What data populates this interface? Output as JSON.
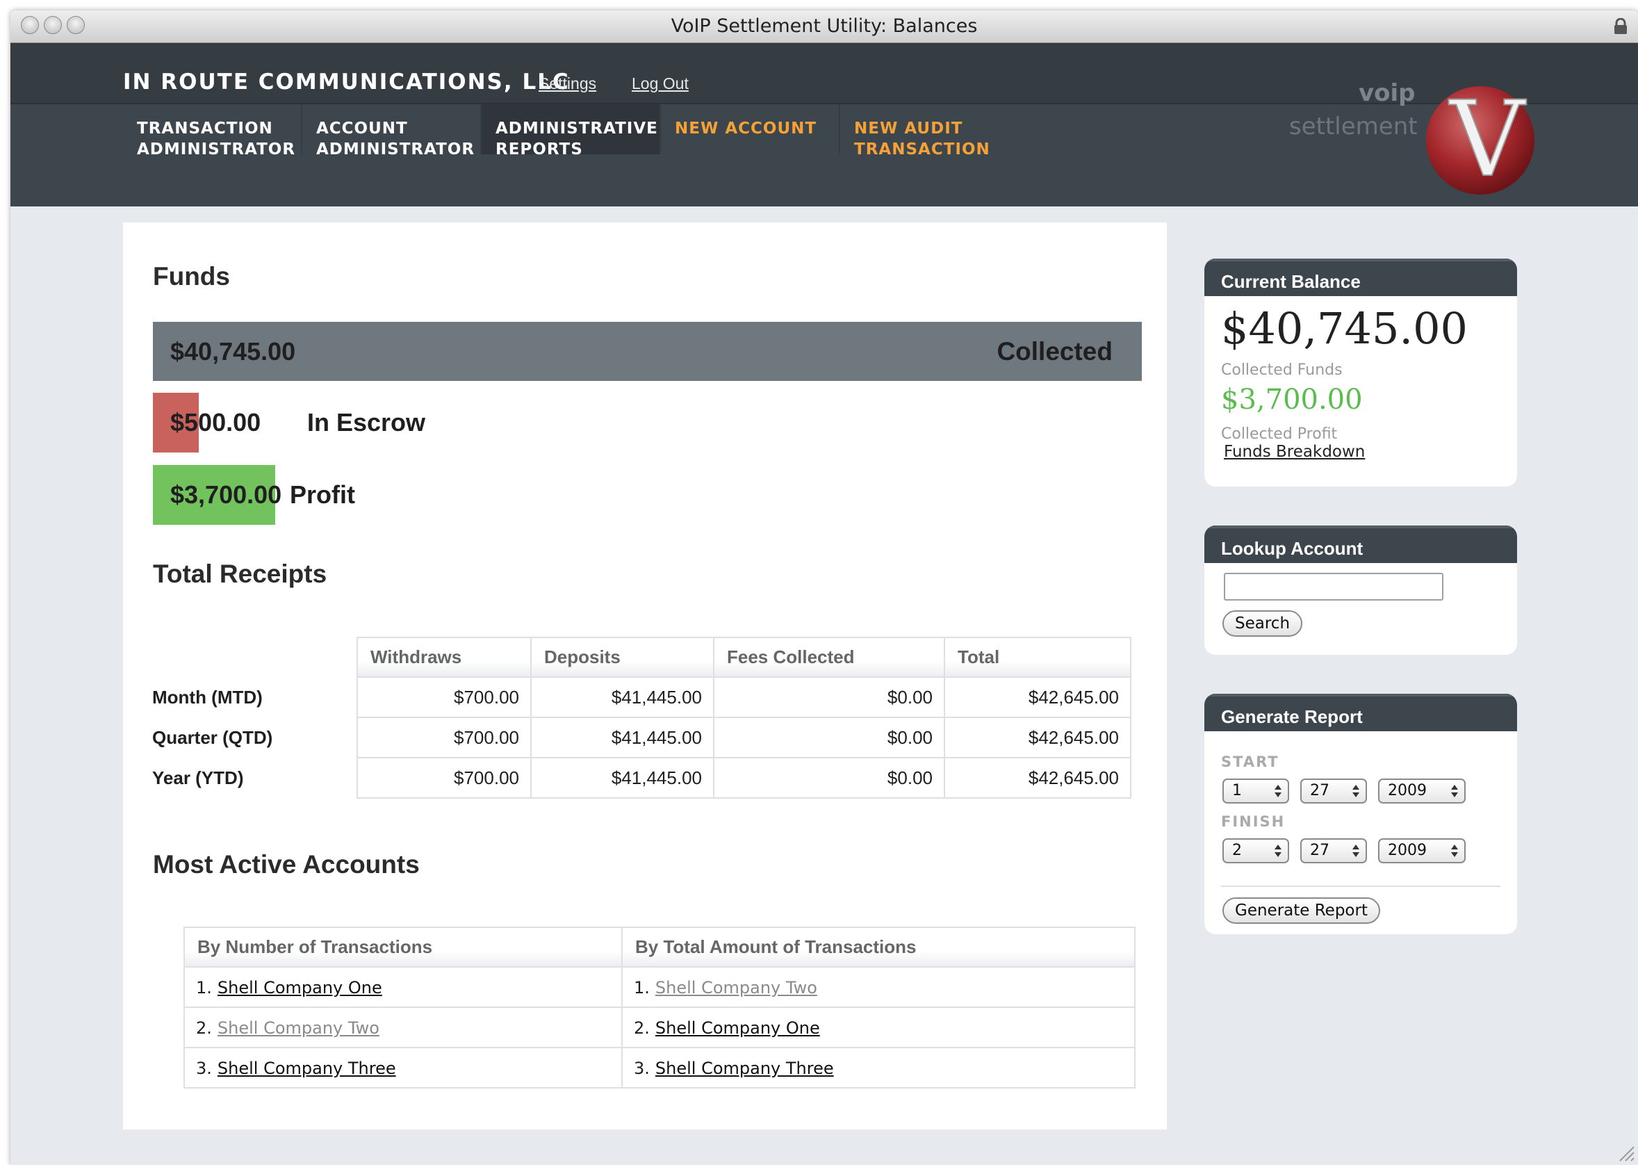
{
  "window": {
    "title": "VoIP Settlement Utility: Balances"
  },
  "header": {
    "company": "IN ROUTE COMMUNICATIONS, LLC",
    "links": {
      "settings": "Settings",
      "logout": "Log Out"
    },
    "logo": {
      "voip": "voip",
      "settlement": "settlement",
      "letter": "V"
    }
  },
  "nav": [
    {
      "label": "TRANSACTION\nADMINISTRATOR"
    },
    {
      "label": "ACCOUNT\nADMINISTRATOR"
    },
    {
      "label": "ADMINISTRATIVE\nREPORTS"
    },
    {
      "label": "NEW ACCOUNT"
    },
    {
      "label": "NEW AUDIT\nTRANSACTION"
    }
  ],
  "funds": {
    "title": "Funds",
    "collected": {
      "value": "$40,745.00",
      "label": "Collected"
    },
    "escrow": {
      "value": "$500.00",
      "label": "In Escrow"
    },
    "profit": {
      "value": "$3,700.00",
      "label": "Profit"
    },
    "colors": {
      "collected": "#70787f",
      "escrow": "#c9625c",
      "profit": "#72c35d"
    }
  },
  "receipts": {
    "title": "Total Receipts",
    "columns": [
      "Withdraws",
      "Deposits",
      "Fees Collected",
      "Total"
    ],
    "rows": [
      {
        "label": "Month (MTD)",
        "cells": [
          "$700.00",
          "$41,445.00",
          "$0.00",
          "$42,645.00"
        ]
      },
      {
        "label": "Quarter (QTD)",
        "cells": [
          "$700.00",
          "$41,445.00",
          "$0.00",
          "$42,645.00"
        ]
      },
      {
        "label": "Year (YTD)",
        "cells": [
          "$700.00",
          "$41,445.00",
          "$0.00",
          "$42,645.00"
        ]
      }
    ]
  },
  "active": {
    "title": "Most Active Accounts",
    "columns": [
      "By Number of Transactions",
      "By Total Amount of Transactions"
    ],
    "rows": [
      {
        "left": {
          "rank": "1.",
          "name": "Shell Company One"
        },
        "right": {
          "rank": "1.",
          "name": "Shell Company Two"
        }
      },
      {
        "left": {
          "rank": "2.",
          "name": "Shell Company Two"
        },
        "right": {
          "rank": "2.",
          "name": "Shell Company One"
        }
      },
      {
        "left": {
          "rank": "3.",
          "name": "Shell Company Three"
        },
        "right": {
          "rank": "3.",
          "name": "Shell Company Three"
        }
      }
    ]
  },
  "sidebar": {
    "balance": {
      "title": "Current Balance",
      "collected_value": "$40,745.00",
      "collected_label": "Collected Funds",
      "profit_value": "$3,700.00",
      "profit_label": "Collected Profit",
      "link": "Funds Breakdown"
    },
    "lookup": {
      "title": "Lookup Account",
      "value": "",
      "button": "Search"
    },
    "report": {
      "title": "Generate Report",
      "start_label": "START",
      "start": {
        "month": "1",
        "day": "27",
        "year": "2009"
      },
      "finish_label": "FINISH",
      "finish": {
        "month": "2",
        "day": "27",
        "year": "2009"
      },
      "button": "Generate Report"
    }
  }
}
